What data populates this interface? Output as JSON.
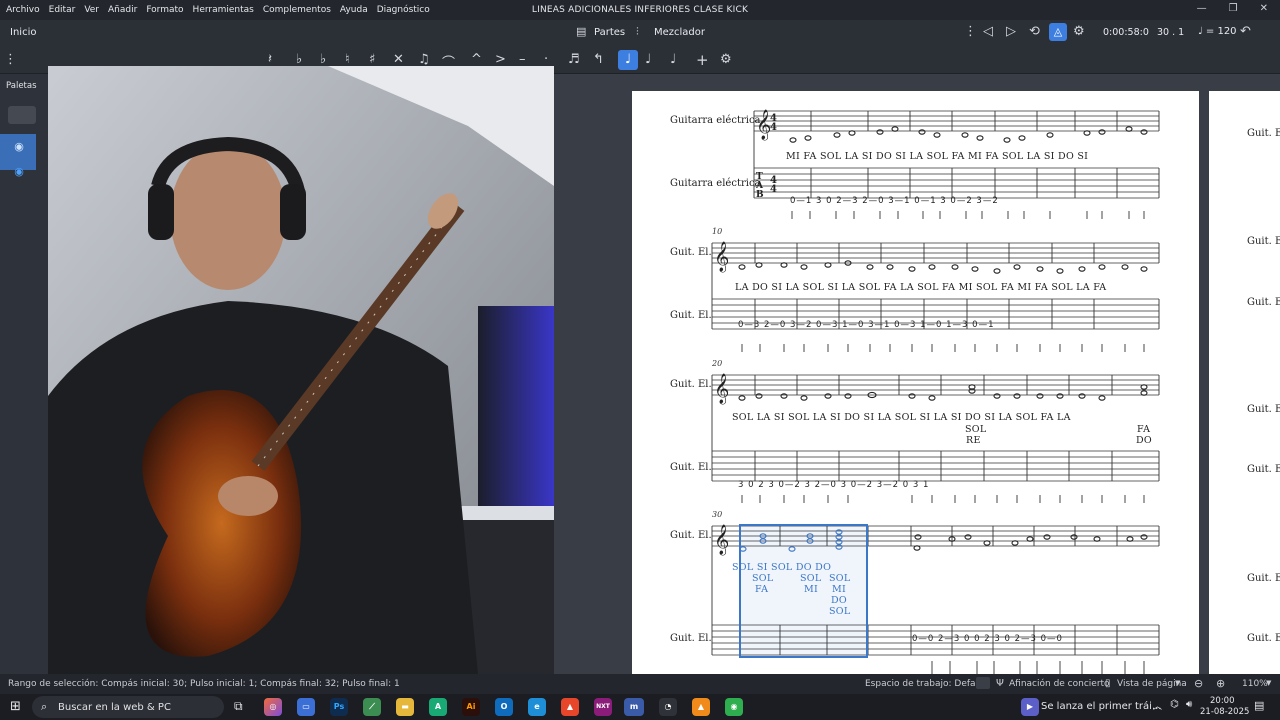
{
  "titlebar": {
    "menu": [
      "Archivo",
      "Editar",
      "Ver",
      "Añadir",
      "Formato",
      "Herramientas",
      "Complementos",
      "Ayuda",
      "Diagnóstico"
    ],
    "window_title": "LINEAS ADICIONALES INFERIORES CLASE KICK",
    "minimize": "—",
    "restore": "❐",
    "close": "✕"
  },
  "toolbar": {
    "home_tab": "Inicio",
    "parts_label": "Partes",
    "mixer_label": "Mezclador",
    "time": "0:00:58:0",
    "position": "30 . 1",
    "tempo": "♩ = 120"
  },
  "left_panel": {
    "palettes_label": "Paletas"
  },
  "score": {
    "instrument_full": "Guitarra eléctrica",
    "instrument_short": "Guit. El.",
    "measure_numbers": [
      "10",
      "20",
      "30"
    ],
    "sys1_notes": "MI FA   SOL LA   SI  DO   SI  LA   SOL FA   MI  FA   SOL        LA  SI   DO  SI",
    "sys1_tab": "0—1   3    0  2—3   2—0    3—1    0—1   3    0—2   3—2",
    "sys2_notes": "LA  DO   SI  LA   SOL SI   LA SOL  FA  LA   SOL FA   MI SOL  FA  MI   FA SOL  LA  FA",
    "sys2_tab": "0—3   2—0    3—2   0—3   1—0   3—1    0—3   1—0   1—3    0—1",
    "sys3_notes": "SOL LA   SI SOL   LA  SI     DO        SI  LA   SOL  SI   LA   SI    DO  SI   LA SOL  FA  LA",
    "sys3_chord1": [
      "SOL",
      "RE"
    ],
    "sys3_chord2": [
      "FA",
      "DO"
    ],
    "sys3_tab": "3   0   2   3   0—2   3    2—0   3    0—2   3—2   0   3   1",
    "sys4_notes": "SOL  SI    SOL DO   DO",
    "sys4_stack1": [
      "SOL",
      "FA"
    ],
    "sys4_stack2": [
      "SOL",
      "MI"
    ],
    "sys4_stack3": [
      "SOL",
      "MI",
      "DO",
      "SOL"
    ],
    "sys4_tab": "0—0   2—3   0   0   2   3   0   2—3   0—0"
  },
  "statusbar": {
    "selection_range": "Rango de selección: Compás inicial: 30; Pulso inicial: 1; Compás final: 32; Pulso final: 1",
    "workspace": "Espacio de trabajo: Default",
    "concert_pitch": "Afinación de concierto",
    "page_view": "Vista de página",
    "zoom": "110%"
  },
  "taskbar": {
    "search_placeholder": "Buscar en la web & PC",
    "news": "Se lanza el primer trái...",
    "time": "20:00",
    "date": "21-08-2025"
  },
  "colors": {
    "accent": "#3d7fe0",
    "selection": "#3a77c8"
  }
}
